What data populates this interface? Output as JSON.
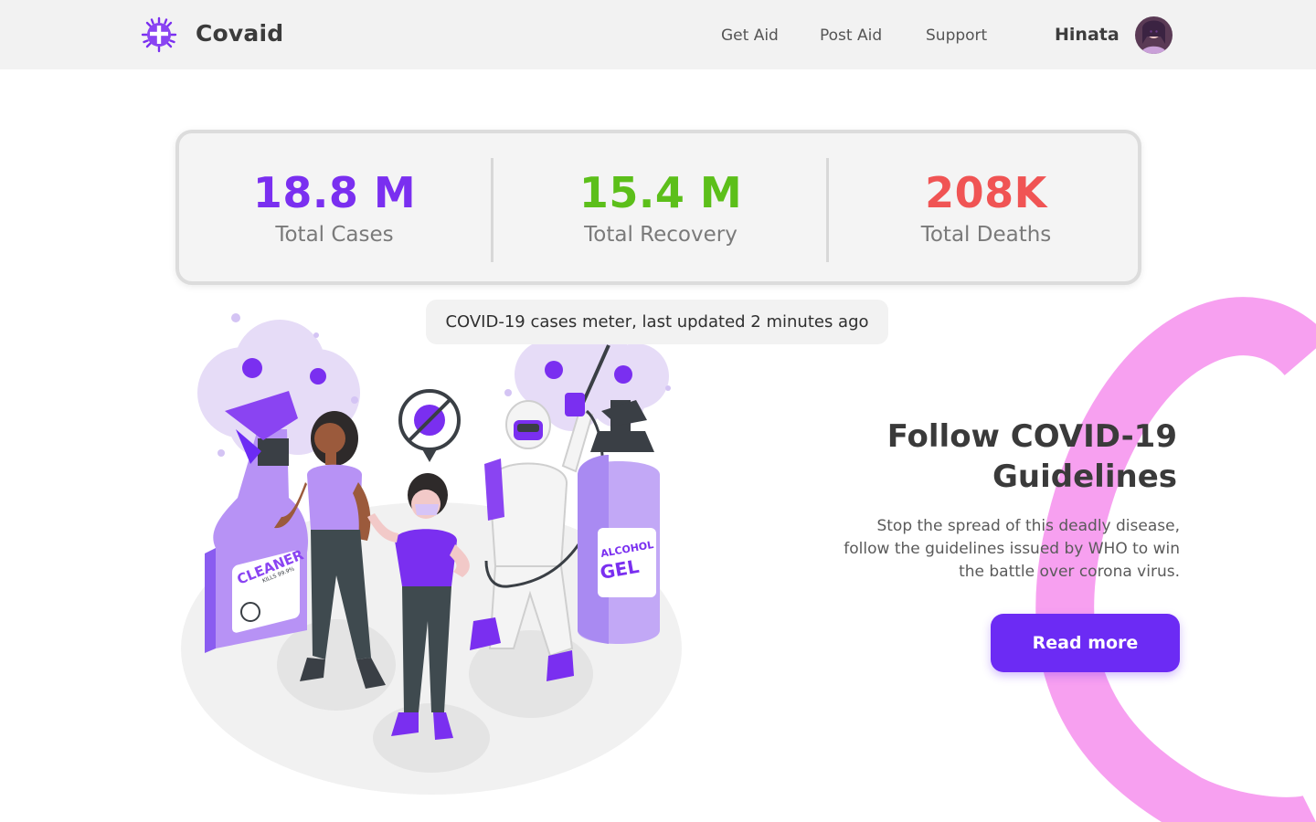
{
  "navbar": {
    "brand": "Covaid",
    "links": [
      "Get Aid",
      "Post Aid",
      "Support"
    ],
    "username": "Hinata",
    "logo_icon": "virus-cross-icon",
    "avatar_icon": "user-avatar"
  },
  "stats": [
    {
      "value": "18.8 M",
      "label": "Total Cases",
      "color": "#7a2ff0"
    },
    {
      "value": "15.4 M",
      "label": "Total Recovery",
      "color": "#5cbf1a"
    },
    {
      "value": "208K",
      "label": "Total Deaths",
      "color": "#f05454"
    }
  ],
  "meter_note": "COVID-19 cases meter, last updated 2 minutes ago",
  "hero": {
    "title_line1": "Follow COVID-19",
    "title_line2": "Guidelines",
    "description_line1": "Stop the spread of this deadly disease,",
    "description_line2": "follow the guidelines issued by WHO to win",
    "description_line3": "the battle over corona virus.",
    "button_label": "Read more"
  },
  "illustration": {
    "cleaner_text": "CLEANER",
    "cleaner_subtext": "KILLS 99.9%",
    "gel_text_1": "ALCOHOL",
    "gel_text_2": "GEL"
  },
  "colors": {
    "accent": "#6c2bf4",
    "deco_pink": "#f7a0f0"
  }
}
